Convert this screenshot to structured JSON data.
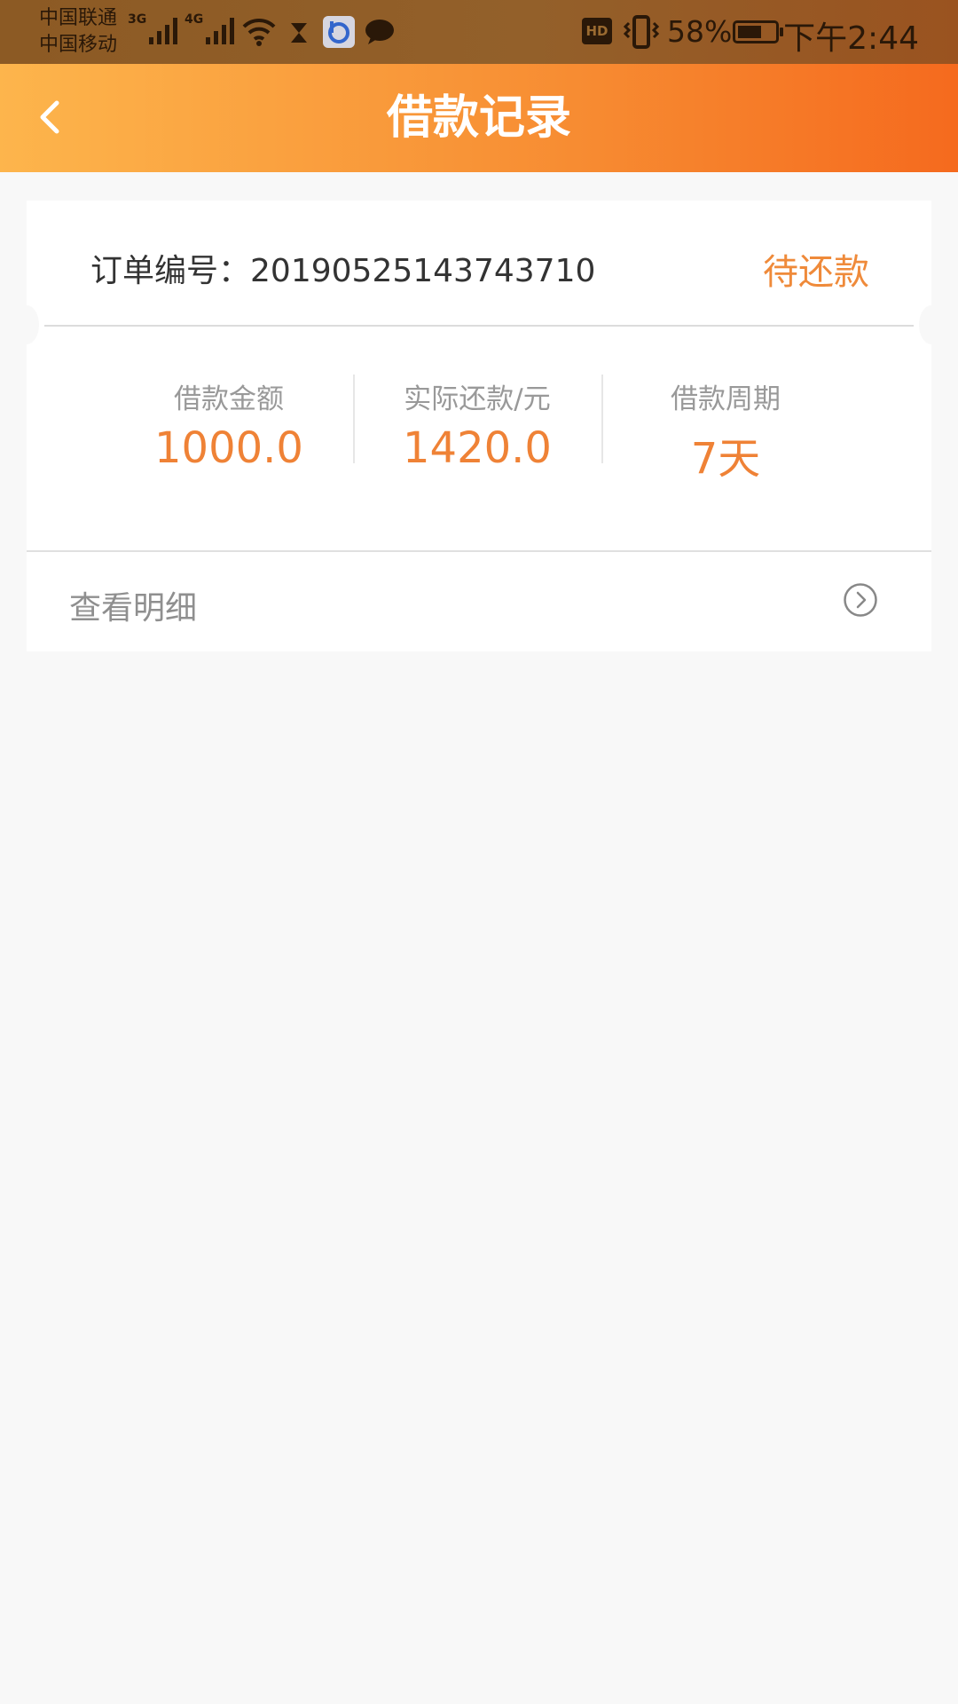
{
  "status_bar": {
    "carrier_1": "中国联通",
    "carrier_2": "中国移动",
    "signal_1_label": "3G",
    "signal_2_label": "4G",
    "hd_label": "HD",
    "battery_percent": "58%",
    "time": "下午2:44",
    "icons": [
      "wifi-icon",
      "hourglass-icon",
      "app-notification-icon",
      "chat-icon",
      "vibrate-icon",
      "battery-icon"
    ]
  },
  "header": {
    "title": "借款记录",
    "back_icon": "chevron-left-icon"
  },
  "order": {
    "label": "订单编号：",
    "number": "20190525143743710",
    "status": "待还款"
  },
  "stats": [
    {
      "label": "借款金额",
      "value": "1000.0"
    },
    {
      "label": "实际还款/元",
      "value": "1420.0"
    },
    {
      "label": "借款周期",
      "value": "7天"
    }
  ],
  "detail": {
    "label": "查看明细",
    "icon": "chevron-right-circle-icon"
  },
  "colors": {
    "accent": "#ef8236",
    "header_start": "#fdb54c",
    "header_end": "#f56a1e",
    "background": "#f8f8f8"
  }
}
